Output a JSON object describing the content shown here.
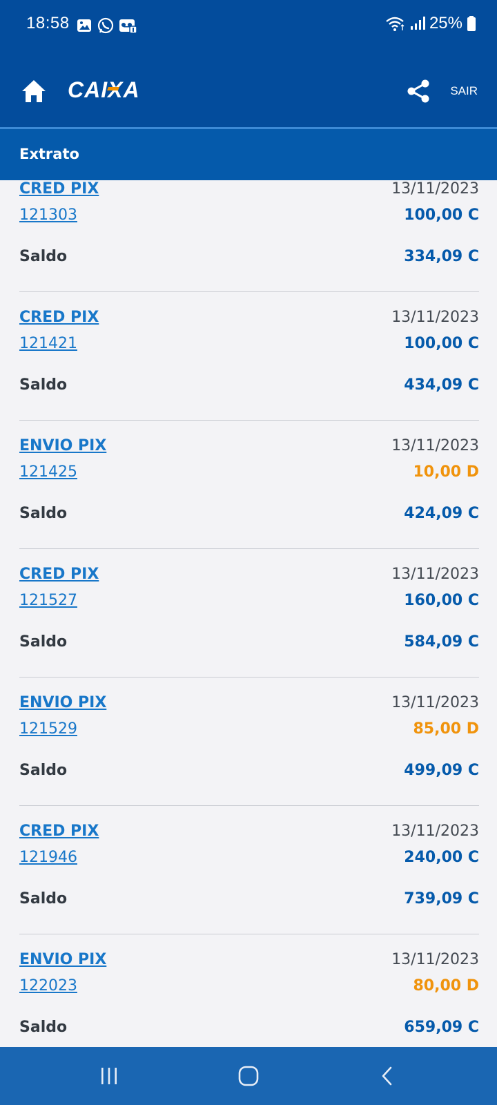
{
  "status_bar": {
    "time": "18:58",
    "battery": "25%",
    "left_icons": [
      "gallery-icon",
      "whatsapp-icon",
      "voicemail-icon"
    ],
    "right_icons": [
      "wifi-icon",
      "signal-icon",
      "battery-icon"
    ]
  },
  "header": {
    "home_icon": "home-icon",
    "logo_text": "CAIXA",
    "share_icon": "share-icon",
    "logout_label": "SAIR"
  },
  "section": {
    "title": "Extrato"
  },
  "entries": [
    {
      "type": "CRED PIX",
      "date": "13/11/2023",
      "doc": "121303",
      "amount": "100,00 C",
      "kind": "credit",
      "saldo_label": "Saldo",
      "saldo": "334,09 C"
    },
    {
      "type": "CRED PIX",
      "date": "13/11/2023",
      "doc": "121421",
      "amount": "100,00 C",
      "kind": "credit",
      "saldo_label": "Saldo",
      "saldo": "434,09 C"
    },
    {
      "type": "ENVIO PIX",
      "date": "13/11/2023",
      "doc": "121425",
      "amount": "10,00 D",
      "kind": "debit",
      "saldo_label": "Saldo",
      "saldo": "424,09 C"
    },
    {
      "type": "CRED PIX",
      "date": "13/11/2023",
      "doc": "121527",
      "amount": "160,00 C",
      "kind": "credit",
      "saldo_label": "Saldo",
      "saldo": "584,09 C"
    },
    {
      "type": "ENVIO PIX",
      "date": "13/11/2023",
      "doc": "121529",
      "amount": "85,00 D",
      "kind": "debit",
      "saldo_label": "Saldo",
      "saldo": "499,09 C"
    },
    {
      "type": "CRED PIX",
      "date": "13/11/2023",
      "doc": "121946",
      "amount": "240,00 C",
      "kind": "credit",
      "saldo_label": "Saldo",
      "saldo": "739,09 C"
    },
    {
      "type": "ENVIO PIX",
      "date": "13/11/2023",
      "doc": "122023",
      "amount": "80,00 D",
      "kind": "debit",
      "saldo_label": "Saldo",
      "saldo": "659,09 C"
    }
  ],
  "colors": {
    "brand_dark": "#034c9c",
    "brand_section": "#055aab",
    "link": "#1877c9",
    "credit": "#055aab",
    "debit": "#f0930c",
    "background": "#f3f3f6"
  },
  "nav_bar": {
    "icons": [
      "recent-apps-icon",
      "home-circle-icon",
      "back-icon"
    ]
  }
}
